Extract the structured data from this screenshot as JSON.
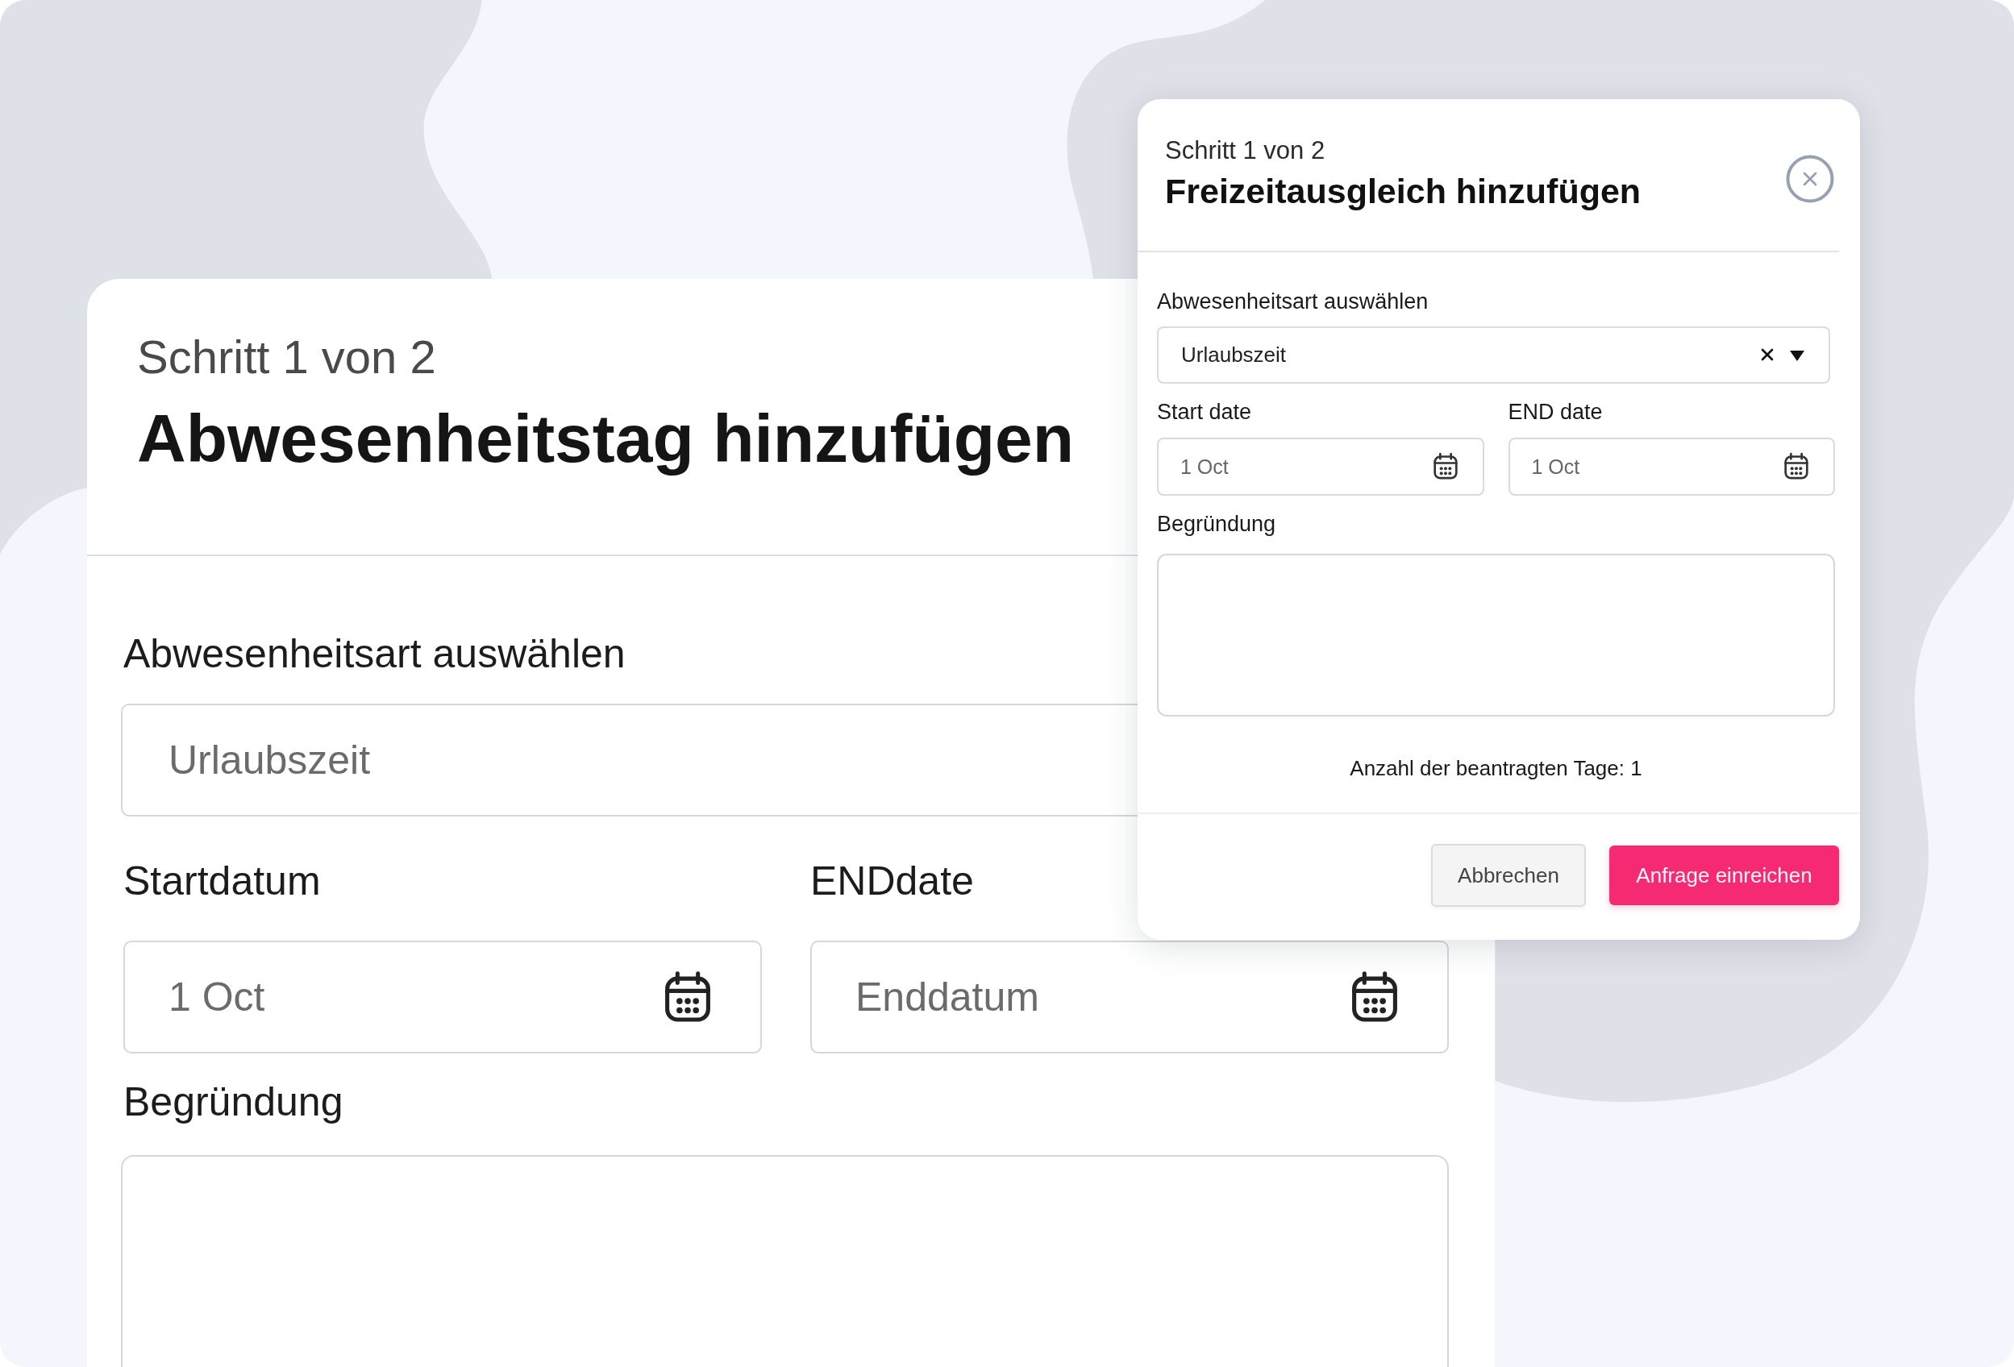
{
  "background_form": {
    "step": "Schritt 1 von 2",
    "title": "Abwesenheitstag hinzufügen",
    "absence_type": {
      "label": "Abwesenheitsart auswählen",
      "value": "Urlaubszeit"
    },
    "start_date": {
      "label": "Startdatum",
      "value": "1 Oct"
    },
    "end_date": {
      "label": "ENDdate",
      "placeholder": "Enddatum"
    },
    "reason": {
      "label": "Begründung"
    }
  },
  "dialog": {
    "step": "Schritt 1 von 2",
    "title": "Freizeitausgleich hinzufügen",
    "absence_type": {
      "label": "Abwesenheitsart auswählen",
      "value": "Urlaubszeit"
    },
    "start_date": {
      "label": "Start date",
      "value": "1 Oct"
    },
    "end_date": {
      "label": "END date",
      "value": "1 Oct"
    },
    "reason": {
      "label": "Begründung"
    },
    "requested_days": "Anzahl der beantragten Tage: 1",
    "buttons": [
      {
        "label": "Abbrechen",
        "kind": "secondary"
      },
      {
        "label": "Anfrage einreichen",
        "kind": "primary"
      }
    ]
  }
}
